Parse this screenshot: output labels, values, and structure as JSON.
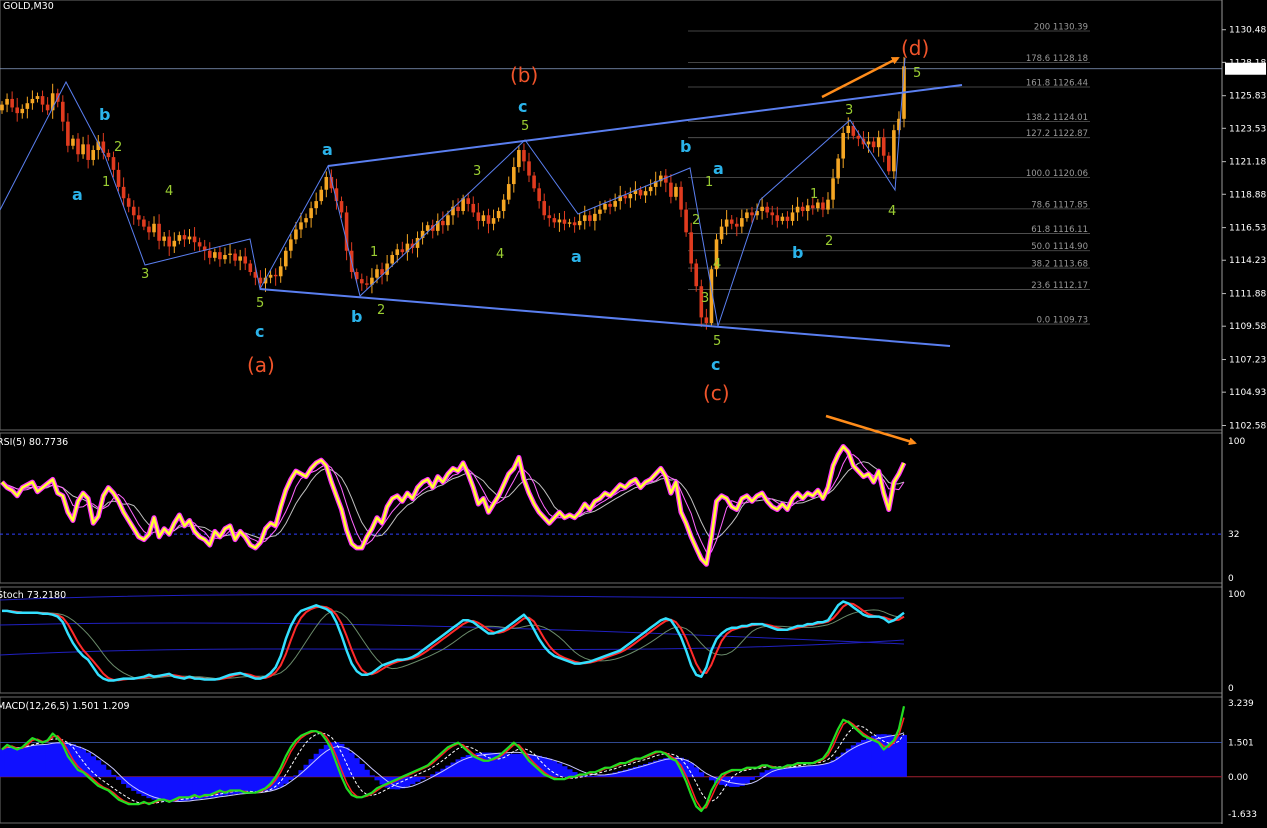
{
  "symbol_label": "GOLD,M30",
  "chart_data": [
    {
      "type": "candlestick",
      "title": "GOLD,M30",
      "ylim": [
        1102.58,
        1130.39
      ],
      "price_scale": [
        "1130.48",
        "1128.18",
        "1125.83",
        "1123.53",
        "1121.18",
        "1118.88",
        "1116.53",
        "1114.23",
        "1111.88",
        "1109.58",
        "1107.23",
        "1104.93",
        "1102.58"
      ],
      "current_price": "1127.73",
      "fibonacci_levels": [
        {
          "ratio": "200",
          "price": "1130.39"
        },
        {
          "ratio": "178.6",
          "price": "1128.18"
        },
        {
          "ratio": "161.8",
          "price": "1126.44"
        },
        {
          "ratio": "138.2",
          "price": "1124.01"
        },
        {
          "ratio": "127.2",
          "price": "1122.87"
        },
        {
          "ratio": "100.0",
          "price": "1120.06"
        },
        {
          "ratio": "78.6",
          "price": "1117.85"
        },
        {
          "ratio": "61.8",
          "price": "1116.11"
        },
        {
          "ratio": "50.0",
          "price": "1114.90"
        },
        {
          "ratio": "38.2",
          "price": "1113.68"
        },
        {
          "ratio": "23.6",
          "price": "1112.17"
        },
        {
          "ratio": "0.0",
          "price": "1109.73"
        }
      ],
      "wave_labels_major": [
        "(a)",
        "(b)",
        "(c)",
        "(d)"
      ],
      "wave_labels_minor": [
        "b",
        "a",
        "c",
        "a",
        "b",
        "c",
        "a",
        "b",
        "a",
        "b",
        "c"
      ],
      "wave_numbers": [
        "2",
        "1",
        "4",
        "3",
        "5",
        "1",
        "2",
        "3",
        "4",
        "5",
        "2",
        "1",
        "4",
        "3",
        "5",
        "1",
        "2",
        "3",
        "4",
        "5"
      ],
      "close_path": [
        1125.2,
        1125.6,
        1125.0,
        1124.6,
        1124.9,
        1125.3,
        1125.6,
        1125.8,
        1125.2,
        1124.8,
        1126.0,
        1125.4,
        1124.0,
        1122.3,
        1122.8,
        1121.7,
        1122.4,
        1121.3,
        1122.0,
        1122.6,
        1121.8,
        1121.5,
        1120.6,
        1119.4,
        1118.6,
        1118.0,
        1117.4,
        1117.1,
        1116.6,
        1116.2,
        1116.8,
        1115.6,
        1115.9,
        1115.2,
        1115.6,
        1116.0,
        1115.7,
        1115.9,
        1115.5,
        1115.2,
        1114.9,
        1114.4,
        1114.8,
        1114.3,
        1114.6,
        1114.7,
        1114.2,
        1114.5,
        1114.0,
        1113.4,
        1113.0,
        1112.6,
        1113.0,
        1113.2,
        1113.1,
        1113.8,
        1114.9,
        1115.7,
        1116.4,
        1116.9,
        1117.2,
        1117.9,
        1118.4,
        1119.2,
        1120.1,
        1119.3,
        1118.4,
        1117.6,
        1114.9,
        1113.4,
        1112.9,
        1112.6,
        1112.5,
        1113.0,
        1113.6,
        1113.2,
        1114.0,
        1114.6,
        1115.0,
        1114.8,
        1115.4,
        1115.1,
        1115.8,
        1116.3,
        1116.7,
        1116.3,
        1117.0,
        1116.7,
        1117.4,
        1118.0,
        1117.7,
        1118.6,
        1118.2,
        1117.6,
        1117.0,
        1117.4,
        1116.8,
        1117.2,
        1117.7,
        1118.5,
        1119.6,
        1120.8,
        1122.0,
        1121.2,
        1120.2,
        1119.3,
        1118.4,
        1117.4,
        1117.2,
        1116.9,
        1117.1,
        1116.8,
        1116.9,
        1116.7,
        1117.0,
        1117.4,
        1117.0,
        1117.5,
        1117.8,
        1118.2,
        1118.0,
        1118.4,
        1118.8,
        1118.6,
        1118.9,
        1119.2,
        1118.8,
        1119.1,
        1119.4,
        1119.8,
        1120.2,
        1119.7,
        1118.7,
        1119.4,
        1117.8,
        1116.2,
        1114.0,
        1112.4,
        1110.2,
        1109.8,
        1113.6,
        1115.7,
        1116.6,
        1117.1,
        1116.8,
        1116.6,
        1117.2,
        1117.6,
        1117.4,
        1117.7,
        1118.0,
        1117.6,
        1117.4,
        1117.0,
        1117.3,
        1117.0,
        1117.6,
        1118.0,
        1117.7,
        1118.1,
        1117.9,
        1118.3,
        1117.8,
        1118.5,
        1120.0,
        1121.4,
        1123.2,
        1123.7,
        1123.0,
        1122.8,
        1122.4,
        1122.6,
        1122.2,
        1122.9,
        1121.6,
        1120.5,
        1123.4,
        1124.2,
        1127.9
      ]
    },
    {
      "type": "line",
      "title": "RSI(5) 80.7736",
      "ylim": [
        0,
        100
      ],
      "level": 32,
      "scale_labels": [
        "100",
        "32",
        "0"
      ],
      "series_values": [
        70,
        66,
        64,
        60,
        66,
        68,
        70,
        63,
        66,
        69,
        72,
        62,
        60,
        48,
        42,
        56,
        62,
        58,
        40,
        45,
        60,
        66,
        62,
        56,
        48,
        42,
        36,
        30,
        28,
        32,
        44,
        30,
        36,
        32,
        40,
        46,
        38,
        42,
        34,
        30,
        28,
        24,
        34,
        30,
        36,
        38,
        28,
        34,
        30,
        24,
        22,
        26,
        36,
        40,
        38,
        52,
        64,
        72,
        78,
        76,
        74,
        80,
        84,
        86,
        82,
        70,
        60,
        50,
        35,
        25,
        22,
        22,
        30,
        36,
        44,
        40,
        52,
        58,
        60,
        56,
        62,
        58,
        66,
        70,
        72,
        66,
        74,
        70,
        76,
        80,
        78,
        84,
        76,
        66,
        54,
        58,
        48,
        54,
        60,
        68,
        76,
        80,
        88,
        72,
        62,
        54,
        48,
        44,
        40,
        44,
        48,
        44,
        46,
        44,
        48,
        54,
        50,
        56,
        58,
        62,
        60,
        64,
        68,
        66,
        70,
        72,
        66,
        70,
        72,
        76,
        80,
        74,
        62,
        70,
        48,
        40,
        30,
        22,
        14,
        10,
        30,
        56,
        60,
        58,
        52,
        50,
        58,
        60,
        56,
        60,
        62,
        56,
        52,
        50,
        54,
        50,
        58,
        62,
        58,
        62,
        60,
        64,
        58,
        66,
        82,
        90,
        96,
        92,
        82,
        78,
        74,
        76,
        70,
        78,
        62,
        50,
        70,
        76,
        84
      ]
    },
    {
      "type": "line",
      "title": "Stoch 73.2180",
      "ylim": [
        0,
        100
      ],
      "scale_labels": [
        "100",
        "0"
      ],
      "series_values": [
        82,
        82,
        81,
        80,
        80,
        80,
        80,
        80,
        79,
        79,
        78,
        76,
        70,
        58,
        48,
        40,
        34,
        30,
        22,
        14,
        10,
        8,
        8,
        9,
        10,
        10,
        10,
        11,
        12,
        14,
        12,
        13,
        14,
        15,
        12,
        11,
        10,
        12,
        10,
        10,
        9,
        9,
        9,
        10,
        12,
        14,
        15,
        16,
        14,
        12,
        10,
        10,
        12,
        16,
        22,
        34,
        52,
        66,
        76,
        82,
        84,
        86,
        88,
        86,
        84,
        80,
        70,
        56,
        40,
        26,
        18,
        14,
        14,
        16,
        20,
        24,
        26,
        28,
        30,
        30,
        31,
        33,
        36,
        40,
        44,
        48,
        52,
        56,
        60,
        64,
        68,
        72,
        72,
        70,
        66,
        62,
        58,
        58,
        60,
        62,
        66,
        70,
        74,
        78,
        72,
        62,
        52,
        44,
        38,
        34,
        32,
        30,
        28,
        26,
        26,
        27,
        28,
        30,
        32,
        34,
        36,
        38,
        40,
        44,
        48,
        52,
        56,
        60,
        64,
        68,
        72,
        74,
        72,
        64,
        54,
        40,
        24,
        14,
        12,
        22,
        40,
        52,
        58,
        62,
        64,
        64,
        66,
        66,
        68,
        68,
        68,
        66,
        64,
        62,
        62,
        62,
        64,
        66,
        66,
        68,
        68,
        70,
        70,
        72,
        80,
        88,
        92,
        90,
        86,
        82,
        78,
        76,
        76,
        76,
        74,
        70,
        72,
        76,
        80
      ]
    },
    {
      "type": "line",
      "title": "MACD(12,26,5) 1.501 1.209",
      "ylim": [
        -1.633,
        3.239
      ],
      "scale_labels": [
        "3.239",
        "1.501",
        "0.00",
        "-1.633"
      ],
      "series_values": [
        1.2,
        1.4,
        1.3,
        1.2,
        1.3,
        1.5,
        1.7,
        1.6,
        1.5,
        1.6,
        1.9,
        1.7,
        1.4,
        0.9,
        0.6,
        0.3,
        0.2,
        0.0,
        -0.2,
        -0.4,
        -0.5,
        -0.6,
        -0.8,
        -1.0,
        -1.1,
        -1.2,
        -1.2,
        -1.2,
        -1.1,
        -1.2,
        -1.1,
        -1.0,
        -1.0,
        -1.1,
        -1.0,
        -0.9,
        -0.9,
        -0.9,
        -0.8,
        -0.9,
        -0.8,
        -0.8,
        -0.7,
        -0.6,
        -0.7,
        -0.6,
        -0.6,
        -0.6,
        -0.7,
        -0.7,
        -0.7,
        -0.6,
        -0.5,
        -0.3,
        0.0,
        0.4,
        0.9,
        1.3,
        1.6,
        1.8,
        1.9,
        2.0,
        2.0,
        1.9,
        1.6,
        1.2,
        0.6,
        0.0,
        -0.5,
        -0.8,
        -0.9,
        -0.9,
        -0.8,
        -0.7,
        -0.5,
        -0.4,
        -0.3,
        -0.2,
        -0.1,
        0.0,
        0.1,
        0.2,
        0.3,
        0.4,
        0.5,
        0.7,
        0.9,
        1.1,
        1.3,
        1.4,
        1.5,
        1.3,
        1.1,
        0.9,
        0.8,
        0.7,
        0.7,
        0.8,
        0.9,
        1.1,
        1.3,
        1.5,
        1.3,
        1.0,
        0.7,
        0.5,
        0.3,
        0.1,
        0.0,
        -0.1,
        -0.1,
        -0.1,
        0.0,
        0.0,
        0.1,
        0.1,
        0.2,
        0.2,
        0.3,
        0.4,
        0.4,
        0.5,
        0.6,
        0.6,
        0.7,
        0.8,
        0.8,
        0.9,
        1.0,
        1.1,
        1.1,
        1.0,
        0.8,
        0.7,
        0.3,
        -0.2,
        -0.8,
        -1.3,
        -1.5,
        -1.2,
        -0.6,
        -0.2,
        0.1,
        0.2,
        0.3,
        0.3,
        0.3,
        0.4,
        0.4,
        0.4,
        0.5,
        0.5,
        0.4,
        0.4,
        0.4,
        0.5,
        0.5,
        0.6,
        0.6,
        0.6,
        0.6,
        0.7,
        0.8,
        1.1,
        1.6,
        2.1,
        2.5,
        2.4,
        2.2,
        2.0,
        1.8,
        1.7,
        1.6,
        1.5,
        1.2,
        1.4,
        1.6,
        2.1,
        3.1
      ]
    }
  ],
  "colors": {
    "background": "#000000",
    "bull_candle": "#f5a623",
    "bear_candle": "#e03b1f",
    "trendline": "#5a7ff0",
    "wave_major": "#f0542a",
    "wave_minor": "#2bb3ea",
    "wave_number": "#9acd32",
    "arrow": "#ff8c1a",
    "rsi": "#ffff33",
    "rsi_glow": "#ff33ff",
    "stoch": "#33e0ff",
    "macd_hist": "#1010ff",
    "macd_line": "#22dd22",
    "macd_signal": "#ff2222"
  }
}
